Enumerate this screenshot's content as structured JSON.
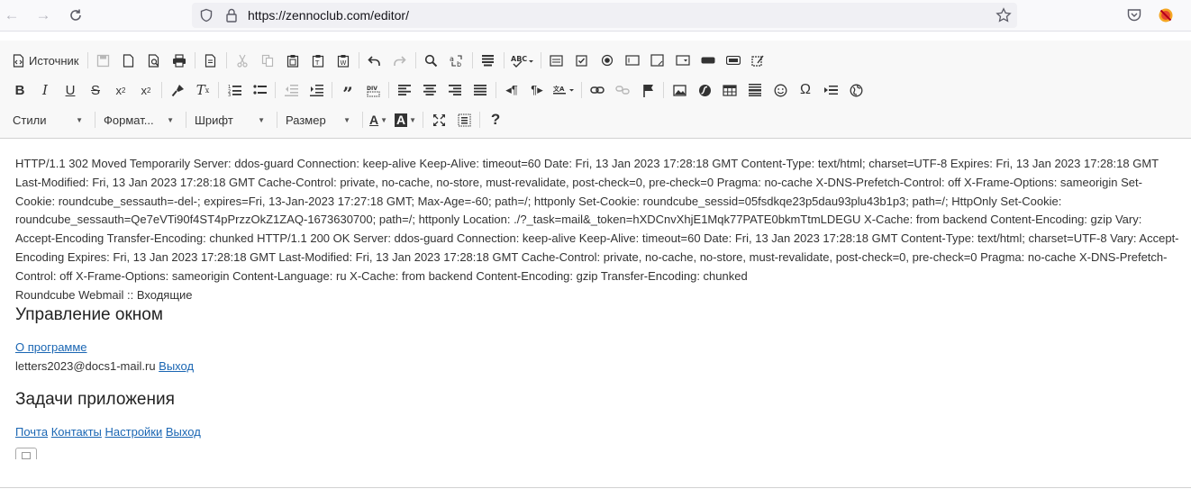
{
  "browser": {
    "url": "https://zennoclub.com/editor/"
  },
  "toolbar": {
    "source_label": "Источник",
    "styles_label": "Стили",
    "format_label": "Формат...",
    "font_label": "Шрифт",
    "size_label": "Размер"
  },
  "content": {
    "headers_text": "HTTP/1.1 302 Moved Temporarily Server: ddos-guard Connection: keep-alive Keep-Alive: timeout=60 Date: Fri, 13 Jan 2023 17:28:18 GMT Content-Type: text/html; charset=UTF-8 Expires: Fri, 13 Jan 2023 17:28:18 GMT Last-Modified: Fri, 13 Jan 2023 17:28:18 GMT Cache-Control: private, no-cache, no-store, must-revalidate, post-check=0, pre-check=0 Pragma: no-cache X-DNS-Prefetch-Control: off X-Frame-Options: sameorigin Set-Cookie: roundcube_sessauth=-del-; expires=Fri, 13-Jan-2023 17:27:18 GMT; Max-Age=-60; path=/; httponly Set-Cookie: roundcube_sessid=05fsdkqe23p5dau93plu43b1p3; path=/; HttpOnly Set-Cookie: roundcube_sessauth=Qe7eVTi90f4ST4pPrzzOkZ1ZAQ-1673630700; path=/; httponly Location: ./?_task=mail&_token=hXDCnvXhjE1Mqk77PATE0bkmTtmLDEGU X-Cache: from backend Content-Encoding: gzip Vary: Accept-Encoding Transfer-Encoding: chunked HTTP/1.1 200 OK Server: ddos-guard Connection: keep-alive Keep-Alive: timeout=60 Date: Fri, 13 Jan 2023 17:28:18 GMT Content-Type: text/html; charset=UTF-8 Vary: Accept-Encoding Expires: Fri, 13 Jan 2023 17:28:18 GMT Last-Modified: Fri, 13 Jan 2023 17:28:18 GMT Cache-Control: private, no-cache, no-store, must-revalidate, post-check=0, pre-check=0 Pragma: no-cache X-DNS-Prefetch-Control: off X-Frame-Options: sameorigin Content-Language: ru X-Cache: from backend Content-Encoding: gzip Transfer-Encoding: chunked",
    "page_title": "Roundcube Webmail :: Входящие",
    "heading_window": "Управление окном",
    "link_about": "О программе",
    "user_email": "letters2023@docs1-mail.ru",
    "link_logout": "Выход",
    "heading_tasks": "Задачи приложения",
    "task_links": [
      "Почта",
      "Контакты",
      "Настройки",
      "Выход"
    ]
  }
}
